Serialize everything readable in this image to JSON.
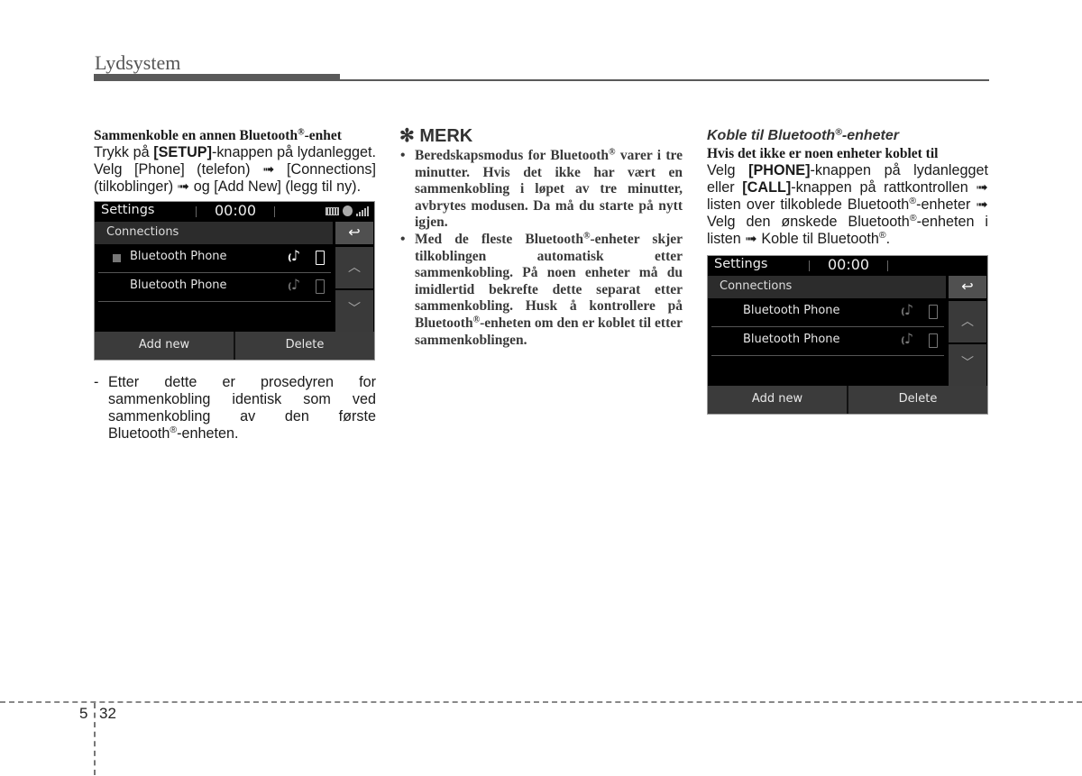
{
  "header": {
    "title": "Lydsystem"
  },
  "col1": {
    "heading": "Sammenkoble en annen Bluetooth",
    "heading_reg": "®",
    "heading_suffix": "-enhet",
    "p_before": "Trykk på ",
    "p_setup": "[SETUP]",
    "p_after": "-knappen på lydanlegget. Velg [Phone] (telefon) ➟ [Connections] (tilkoblinger) ➟ og [Add New] (legg til ny).",
    "note_dash": "-",
    "note_before": "Etter dette er prosedyren for sammenkobling identisk som ved sammenkobling av den første Bluetooth",
    "note_reg": "®",
    "note_after": "-enheten."
  },
  "merk": {
    "title": "✻ MERK",
    "bullet": "•",
    "item1_before": "Beredskapsmodus for Bluetooth",
    "item1_reg": "®",
    "item1_after": " varer i tre minutter. Hvis det ikke har vært en sammenkobling i løpet av tre minutter, avbrytes modusen. Da må du starte på nytt igjen.",
    "item2_a": "Med de fleste Bluetooth",
    "item2_reg": "®",
    "item2_b": "-enheter skjer tilkoblingen automatisk etter sammenkobling. På noen enheter må du imidlertid bekrefte dette separat etter sammenkobling. Husk å kontrollere på Bluetooth",
    "item2_reg2": "®",
    "item2_c": "-enheten om den er koblet til etter sammenkoblingen."
  },
  "col3": {
    "italic_heading": "Koble til Bluetooth",
    "italic_reg": "®",
    "italic_suffix": "-enheter",
    "sub_heading": "Hvis det ikke er noen enheter koblet til",
    "p1": "Velg ",
    "p_phone": "[PHONE]",
    "p2": "-knappen på lydanlegget eller ",
    "p_call": "[CALL]",
    "p3": "-knappen på rattkontrollen ➟ listen over tilkoblede Bluetooth",
    "p_reg1": "®",
    "p4": "-enheter ➟ Velg den ønskede Bluetooth",
    "p_reg2": "®",
    "p5": "-enheten i listen ➟ Koble til Bluetooth",
    "p_reg3": "®",
    "p6": "."
  },
  "screen1": {
    "title": "Settings",
    "time": "00:00",
    "subheader": "Connections",
    "back_icon": "↩",
    "devices": [
      {
        "name": "Bluetooth Phone",
        "selected": true
      },
      {
        "name": "Bluetooth Phone",
        "selected": false
      }
    ],
    "up_icon": "︿",
    "down_icon": "﹀",
    "add_new": "Add new",
    "delete": "Delete"
  },
  "screen2": {
    "title": "Settings",
    "time": "00:00",
    "subheader": "Connections",
    "back_icon": "↩",
    "devices": [
      {
        "name": "Bluetooth Phone",
        "selected": false
      },
      {
        "name": "Bluetooth Phone",
        "selected": false
      }
    ],
    "up_icon": "︿",
    "down_icon": "﹀",
    "add_new": "Add new",
    "delete": "Delete"
  },
  "icons": {
    "music": "♪",
    "waves": "(("
  },
  "footer": {
    "chapter": "5",
    "page": "32"
  }
}
